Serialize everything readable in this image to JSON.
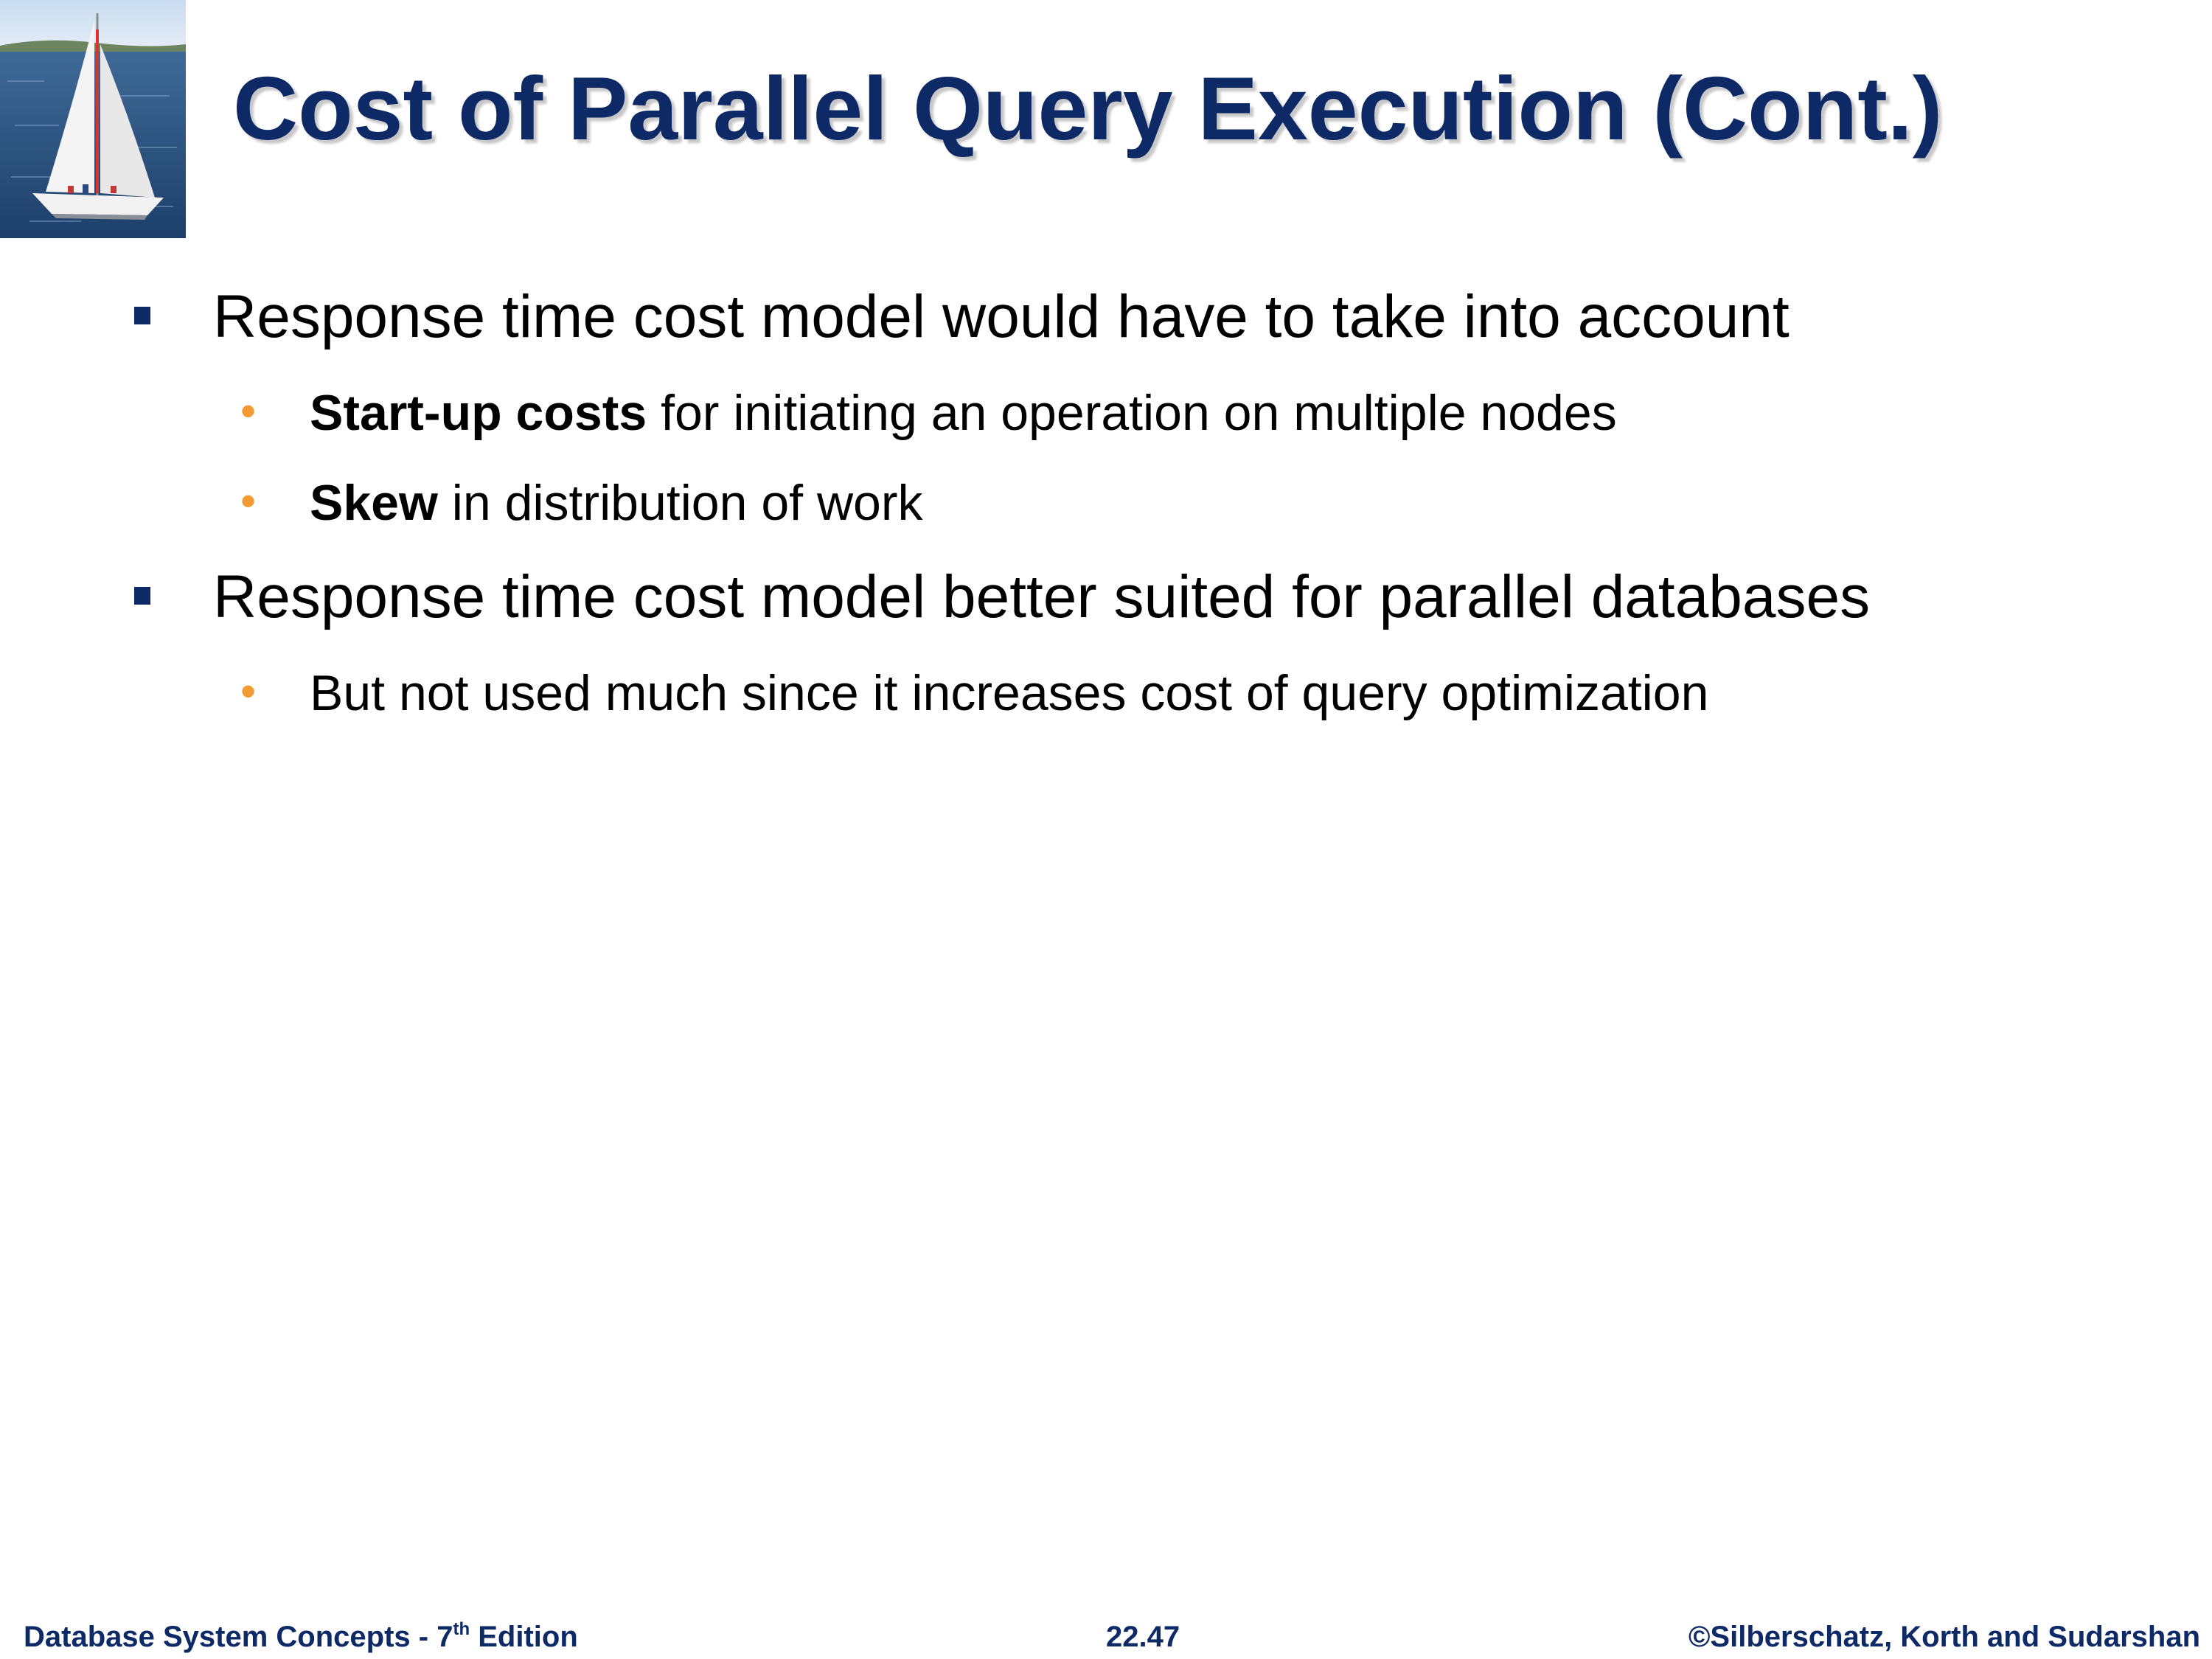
{
  "slide": {
    "title": "Cost of Parallel Query Execution (Cont.)",
    "bullets": [
      {
        "text": "Response time cost model would have to take into account",
        "sub": [
          {
            "bold": "Start-up costs",
            "text": " for initiating an operation on multiple nodes"
          },
          {
            "bold": "Skew",
            "text": " in distribution of work"
          }
        ]
      },
      {
        "text": "Response time cost model better suited for parallel databases",
        "sub": [
          {
            "bold": "",
            "text": "But not used much since it increases cost of query optimization"
          }
        ]
      }
    ]
  },
  "footer": {
    "left_prefix": "Database System Concepts - 7",
    "left_sup": "th",
    "left_suffix": " Edition",
    "center": "22.47",
    "right": "©Silberschatz, Korth and Sudarshan"
  },
  "colors": {
    "title": "#0d2a66",
    "square_bullet": "#0d2a66",
    "dot_bullet": "#f39a33",
    "footer": "#0d2a66"
  },
  "icons": {
    "logo": "sailboat-photo",
    "level1_marker": "square-bullet",
    "level2_marker": "dot-bullet"
  }
}
